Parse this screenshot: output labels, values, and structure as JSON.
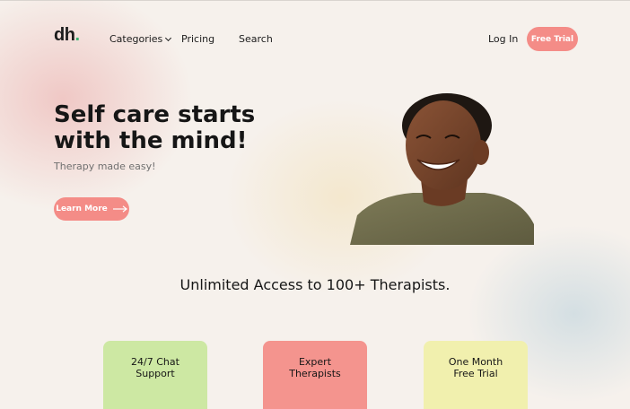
{
  "nav": {
    "logo": "dh",
    "logo_dot": ".",
    "categories": "Categories",
    "pricing": "Pricing",
    "search": "Search",
    "login": "Log In",
    "free_trial": "Free Trial"
  },
  "hero": {
    "title_line1": "Self care starts",
    "title_line2": "with the mind!",
    "subtitle": "Therapy made easy!",
    "cta": "Learn More"
  },
  "section": {
    "title": "Unlimited Access to 100+ Therapists."
  },
  "cards": [
    {
      "line1": "24/7 Chat",
      "line2": "Support"
    },
    {
      "line1": "Expert",
      "line2": "Therapists"
    },
    {
      "line1": "One Month",
      "line2": "Free Trial"
    }
  ],
  "colors": {
    "accent": "#f48c87",
    "background": "#f6f1ec",
    "card_green": "#cde8a3",
    "card_red": "#f4948e",
    "card_yellow": "#f1f0ae",
    "logo_dot": "#3cb371"
  },
  "icons": {
    "categories_toggle": "chevron-down-icon",
    "cta_arrow": "arrow-right-icon"
  }
}
